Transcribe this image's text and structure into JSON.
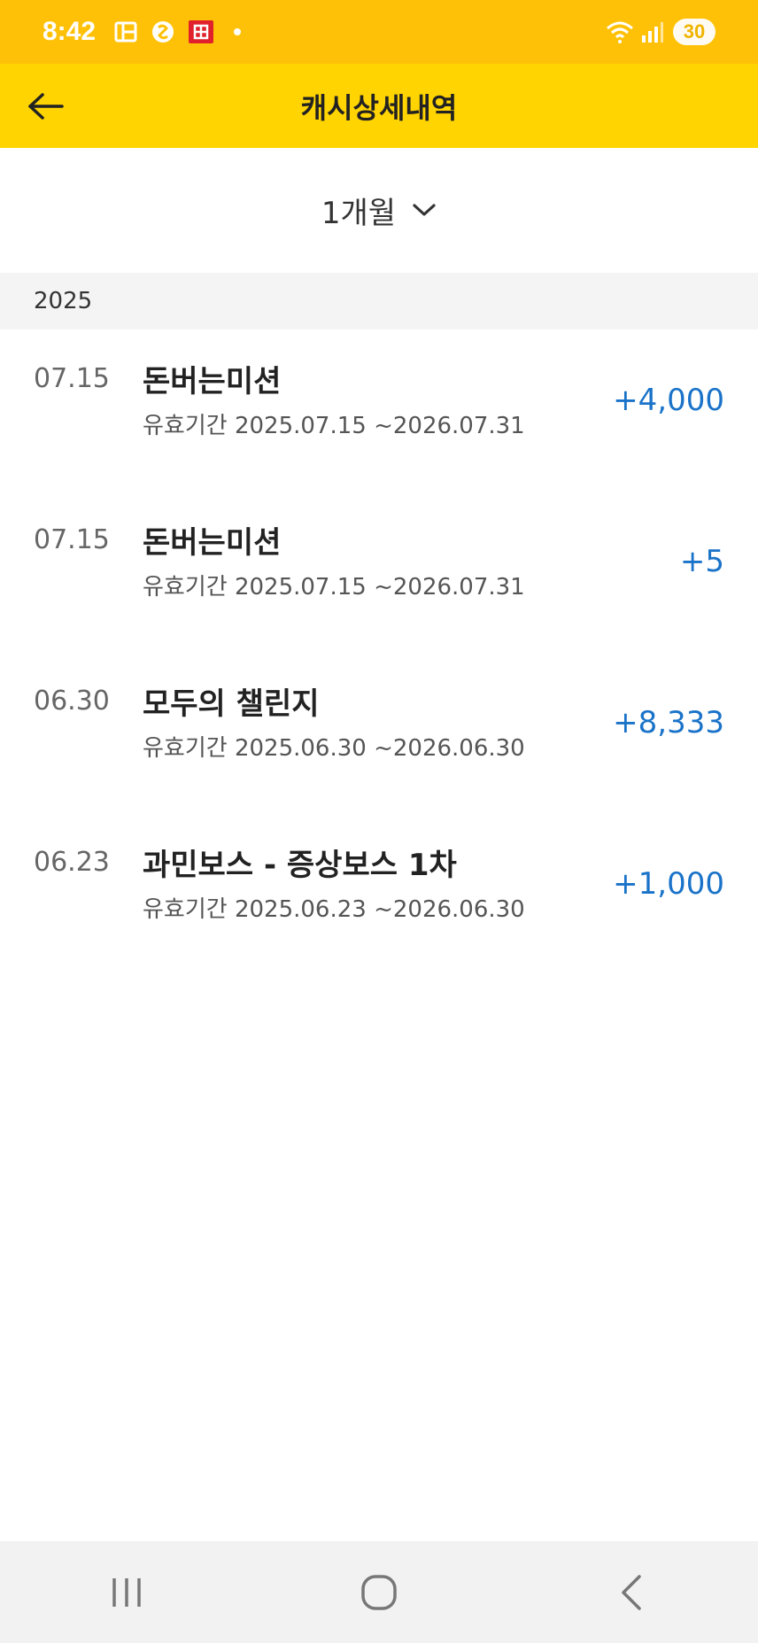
{
  "status_bar": {
    "time": "8:42",
    "battery": "30",
    "icons": [
      "grid-app-icon",
      "samsung-pay-icon",
      "red-app-icon",
      "notification-dot",
      "wifi-icon",
      "signal-icon",
      "battery-icon"
    ]
  },
  "header": {
    "title": "캐시상세내역",
    "back_icon": "arrow-left-icon"
  },
  "filter": {
    "period_label": "1개월",
    "dropdown_icon": "chevron-down-icon"
  },
  "list": {
    "year": "2025",
    "items": [
      {
        "date": "07.15",
        "title": "돈버는미션",
        "validity": "유효기간 2025.07.15 ~2026.07.31",
        "amount": "+4,000"
      },
      {
        "date": "07.15",
        "title": "돈버는미션",
        "validity": "유효기간 2025.07.15 ~2026.07.31",
        "amount": "+5"
      },
      {
        "date": "06.30",
        "title": "모두의 챌린지",
        "validity": "유효기간 2025.06.30 ~2026.06.30",
        "amount": "+8,333"
      },
      {
        "date": "06.23",
        "title": "과민보스 - 증상보스 1차",
        "validity": "유효기간 2025.06.23 ~2026.06.30",
        "amount": "+1,000"
      }
    ]
  },
  "colors": {
    "status_bar": "#ffc107",
    "app_bar": "#ffd400",
    "amount": "#1a73c9",
    "section_bg": "#f4f4f4"
  },
  "nav_bar": {
    "icons": [
      "recent-apps-icon",
      "home-icon",
      "back-icon"
    ]
  }
}
